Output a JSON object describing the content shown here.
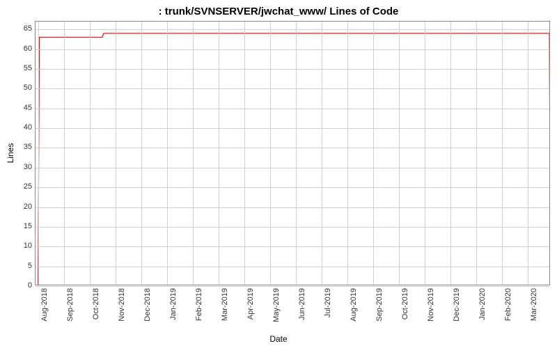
{
  "chart_data": {
    "type": "line",
    "title": ": trunk/SVNSERVER/jwchat_www/ Lines of Code",
    "xlabel": "Date",
    "ylabel": "Lines",
    "ylim": [
      0,
      67
    ],
    "y_ticks": [
      0,
      5,
      10,
      15,
      20,
      25,
      30,
      35,
      40,
      45,
      50,
      55,
      60,
      65
    ],
    "x_categories": [
      "Aug-2018",
      "Sep-2018",
      "Oct-2018",
      "Nov-2018",
      "Dec-2018",
      "Jan-2019",
      "Feb-2019",
      "Mar-2019",
      "Apr-2019",
      "May-2019",
      "Jun-2019",
      "Jul-2019",
      "Aug-2019",
      "Sep-2019",
      "Oct-2019",
      "Nov-2019",
      "Dec-2019",
      "Jan-2020",
      "Feb-2020",
      "Mar-2020"
    ],
    "series": [
      {
        "name": "Lines of Code",
        "color": "#ff0000",
        "points": [
          {
            "x_index": 0.0,
            "y": 0
          },
          {
            "x_index": 0.05,
            "y": 63
          },
          {
            "x_index": 2.5,
            "y": 63
          },
          {
            "x_index": 2.55,
            "y": 64
          },
          {
            "x_index": 19.9,
            "y": 64
          },
          {
            "x_index": 19.95,
            "y": 0
          }
        ]
      }
    ]
  }
}
